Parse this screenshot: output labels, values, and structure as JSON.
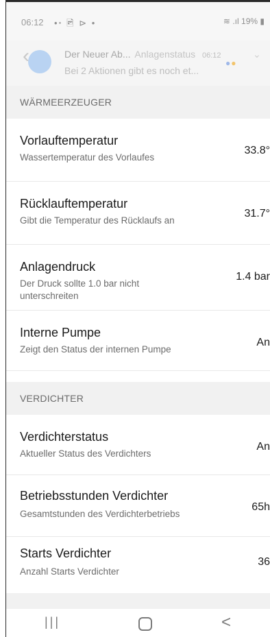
{
  "statusbar": {
    "time": "06:12",
    "left_icons": "•ꞏ 🖻 ⊳ •",
    "right": "19%"
  },
  "notification": {
    "title": "Der Neuer Ab...",
    "overlay_title": "Anlagenstatus",
    "overlay_tag": "Google",
    "time": "06:12",
    "body": "Bei 2 Aktionen gibt es noch et..."
  },
  "sections": {
    "waermeerzeuger": "WÄRMEERZEUGER",
    "verdichter": "VERDICHTER"
  },
  "rows": [
    {
      "title": "Vorlauftemperatur",
      "subtitle": "Wassertemperatur des Vorlaufes",
      "value": "33.8°"
    },
    {
      "title": "Rücklauftemperatur",
      "subtitle": "Gibt die Temperatur des Rücklaufs an",
      "value": "31.7°"
    },
    {
      "title": "Anlagendruck",
      "subtitle": "Der Druck sollte 1.0 bar nicht unterschreiten",
      "value": "1.4 bar"
    },
    {
      "title": "Interne Pumpe",
      "subtitle": "Zeigt den Status der internen Pumpe",
      "value": "An"
    },
    {
      "title": "Verdichterstatus",
      "subtitle": "Aktueller Status des Verdichters",
      "value": "An"
    },
    {
      "title": "Betriebsstunden Verdichter",
      "subtitle": "Gesamtstunden des Verdichterbetriebs",
      "value": "65h"
    },
    {
      "title": "Starts Verdichter",
      "subtitle": "Anzahl Starts Verdichter",
      "value": "36"
    }
  ],
  "navbar": {
    "recent_icon": "recent-apps-icon",
    "home_icon": "home-icon",
    "back_icon": "back-icon"
  }
}
